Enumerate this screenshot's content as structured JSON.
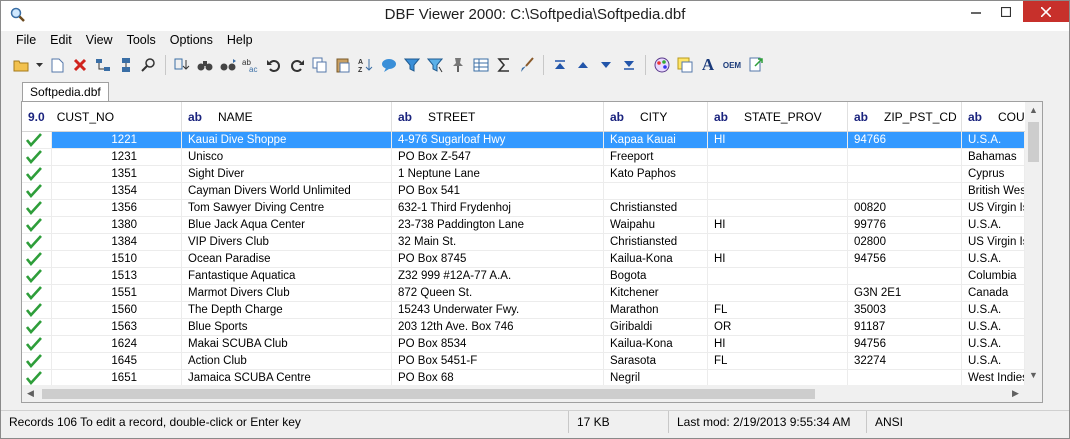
{
  "window": {
    "title": "DBF Viewer 2000: C:\\Softpedia\\Softpedia.dbf"
  },
  "menu": [
    "File",
    "Edit",
    "View",
    "Tools",
    "Options",
    "Help"
  ],
  "toolbar": {
    "icons": [
      "open-folder-icon",
      "dropdown-arrow-icon",
      "new-file-icon",
      "delete-icon",
      "structure-icon",
      "split-icon",
      "find-icon",
      "sort-icon",
      "binoculars-icon",
      "find-next-icon",
      "replace-icon",
      "undo-icon",
      "redo-icon",
      "copy-icon",
      "paste-icon",
      "sort-az-icon",
      "comment-icon",
      "filter-icon",
      "funnel-icon",
      "pin-icon",
      "table-icon",
      "sum-icon",
      "brush-icon",
      "first-record-icon",
      "prev-record-icon",
      "next-record-icon",
      "last-record-icon",
      "color-icon",
      "note-icon",
      "font-icon",
      "oem-icon",
      "export-icon"
    ],
    "oem_label": "OEM",
    "font_glyph": "A"
  },
  "tab": {
    "label": "Softpedia.dbf"
  },
  "grid": {
    "columns": [
      {
        "type": "9.0",
        "name": "CUST_NO"
      },
      {
        "type": "ab",
        "name": "NAME"
      },
      {
        "type": "ab",
        "name": "STREET"
      },
      {
        "type": "ab",
        "name": "CITY"
      },
      {
        "type": "ab",
        "name": "STATE_PROV"
      },
      {
        "type": "ab",
        "name": "ZIP_PST_CD"
      },
      {
        "type": "ab",
        "name": "COUNTRY"
      }
    ],
    "selected_row": 0,
    "rows": [
      [
        "1221",
        "Kauai Dive Shoppe",
        "4-976 Sugarloaf Hwy",
        "Kapaa Kauai",
        "HI",
        "94766",
        "U.S.A."
      ],
      [
        "1231",
        "Unisco",
        "PO Box Z-547",
        "Freeport",
        "",
        "",
        "Bahamas"
      ],
      [
        "1351",
        "Sight Diver",
        "1 Neptune Lane",
        "Kato Paphos",
        "",
        "",
        "Cyprus"
      ],
      [
        "1354",
        "Cayman Divers World Unlimited",
        "PO Box 541",
        "",
        "",
        "",
        "British West Ind"
      ],
      [
        "1356",
        "Tom Sawyer Diving Centre",
        "632-1 Third Frydenhoj",
        "Christiansted",
        "",
        "00820",
        "US Virgin Island"
      ],
      [
        "1380",
        "Blue Jack Aqua Center",
        "23-738 Paddington Lane",
        "Waipahu",
        "HI",
        "99776",
        "U.S.A."
      ],
      [
        "1384",
        "VIP Divers Club",
        "32 Main St.",
        "Christiansted",
        "",
        "02800",
        "US Virgin Island"
      ],
      [
        "1510",
        "Ocean Paradise",
        "PO Box 8745",
        "Kailua-Kona",
        "HI",
        "94756",
        "U.S.A."
      ],
      [
        "1513",
        "Fantastique Aquatica",
        "Z32 999 #12A-77 A.A.",
        "Bogota",
        "",
        "",
        "Columbia"
      ],
      [
        "1551",
        "Marmot Divers Club",
        "872 Queen St.",
        "Kitchener",
        "",
        "G3N 2E1",
        "Canada"
      ],
      [
        "1560",
        "The Depth Charge",
        "15243 Underwater Fwy.",
        "Marathon",
        "FL",
        "35003",
        "U.S.A."
      ],
      [
        "1563",
        "Blue Sports",
        "203 12th Ave. Box 746",
        "Giribaldi",
        "OR",
        "91187",
        "U.S.A."
      ],
      [
        "1624",
        "Makai SCUBA Club",
        "PO Box 8534",
        "Kailua-Kona",
        "HI",
        "94756",
        "U.S.A."
      ],
      [
        "1645",
        "Action Club",
        "PO Box 5451-F",
        "Sarasota",
        "FL",
        "32274",
        "U.S.A."
      ],
      [
        "1651",
        "Jamaica SCUBA Centre",
        "PO Box 68",
        "Negril",
        "",
        "",
        "West Indies"
      ]
    ]
  },
  "status": {
    "records": "Records 106 To edit a record, double-click or Enter key",
    "size": "17 KB",
    "last_mod": "Last mod: 2/19/2013 9:55:34 AM",
    "encoding": "ANSI"
  },
  "colors": {
    "selection": "#3399ff",
    "check": "#2e9e3a",
    "close": "#c7302b"
  }
}
